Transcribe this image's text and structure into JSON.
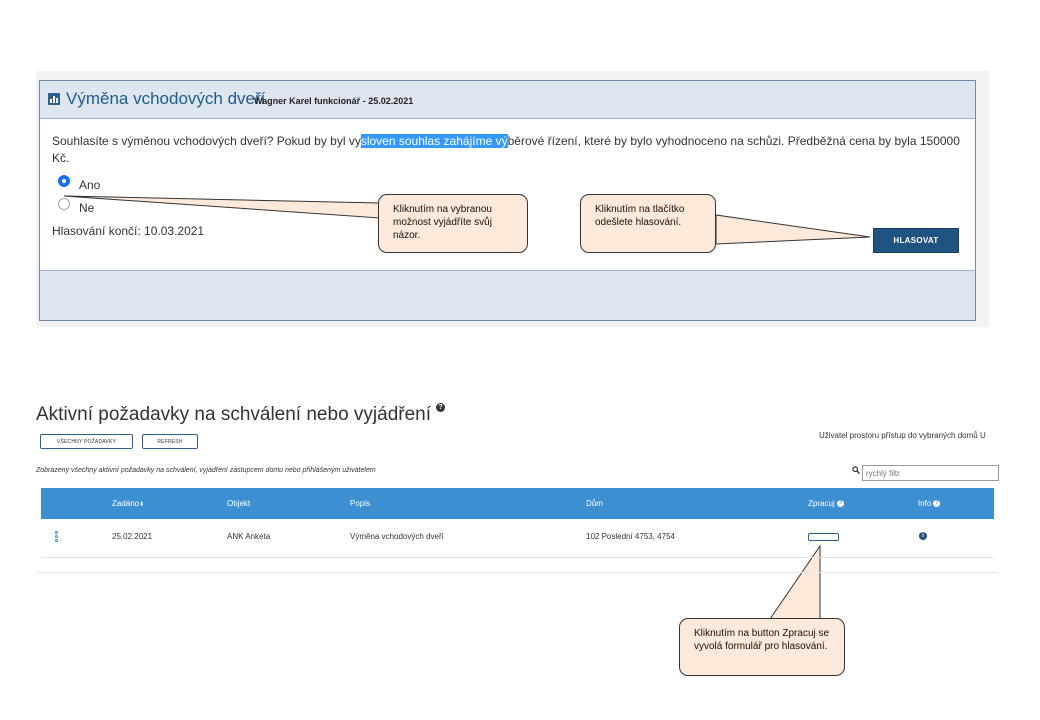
{
  "poll": {
    "title": "Výměna vchodových dveří",
    "subtitle": "Wagner Karel funkcionář - 25.02.2021",
    "question_before": "Souhlasíte s výměnou vchodových dveří? Pokud by byl vy",
    "question_highlight": "sloven souhlas zahájíme vý",
    "question_after": "běrové řízení, které by bylo vyhodnoceno na schůzi. Předběžná cena by byla 150000 Kč.",
    "options": [
      {
        "label": "Ano",
        "selected": true
      },
      {
        "label": "Ne",
        "selected": false
      }
    ],
    "deadline": "Hlasování končí: 10.03.2021",
    "vote_button": "HLASOVAT"
  },
  "callouts": {
    "choose": "Kliknutím na vybranou možnost vyjádříte svůj názor.",
    "vote": "Kliknutím na tlačítko odešlete hlasování.",
    "process": "Kliknutím na button Zpracuj se vyvolá formulář pro hlasování."
  },
  "requests": {
    "title": "Aktivní požadavky na schválení nebo vyjádření",
    "help_icon": "?",
    "btn_all": "VŠECHNY POŽADAVKY",
    "btn_refresh": "REFRESH",
    "user_info": "Uživatel prostoru přístup do vybraných domů U",
    "description": "Zobrazeny všechny aktivní požadavky na schválení, vyjádření zástupcem domu nebo přihlášeným uživatelem",
    "search_placeholder": "rychlý filtr",
    "columns": {
      "zadano": "Zadáno",
      "objekt": "Objekt",
      "popis": "Popis",
      "dum": "Dům",
      "zpracuj": "Zpracuj",
      "info": "Info"
    },
    "rows": [
      {
        "zadano": "25.02.2021",
        "objekt": "ANK Anketa",
        "popis": "Výměna vchodových dveří",
        "dum": "102 Poslední 4753, 4754"
      }
    ]
  },
  "colors": {
    "header_blue": "#3c8fd1",
    "vote_button": "#1f5480",
    "callout_fill": "#fde9d9",
    "selection": "#3399ff"
  },
  "icons": [
    "chart-icon",
    "help-icon",
    "search-icon",
    "row-menu-icon",
    "info-icon"
  ]
}
